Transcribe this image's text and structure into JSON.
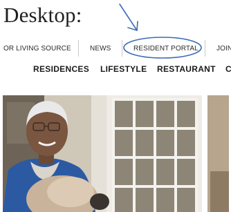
{
  "caption": "Desktop:",
  "utility_nav": {
    "items": [
      {
        "label": "OR LIVING SOURCE"
      },
      {
        "label": "NEWS"
      },
      {
        "label": "RESIDENT PORTAL"
      },
      {
        "label": "JOIN"
      }
    ],
    "highlighted": "RESIDENT PORTAL"
  },
  "main_nav": {
    "items": [
      {
        "label": "RESIDENCES"
      },
      {
        "label": "LIFESTYLE"
      },
      {
        "label": "RESTAURANT"
      },
      {
        "label": "C"
      }
    ]
  },
  "colors": {
    "annotation": "#3b6bb5",
    "text": "#2a2a2a",
    "separator": "#c9c9c9"
  },
  "icons": {
    "annotation_arrow": "down-arrow-icon",
    "annotation_circle": "highlight-ellipse"
  }
}
